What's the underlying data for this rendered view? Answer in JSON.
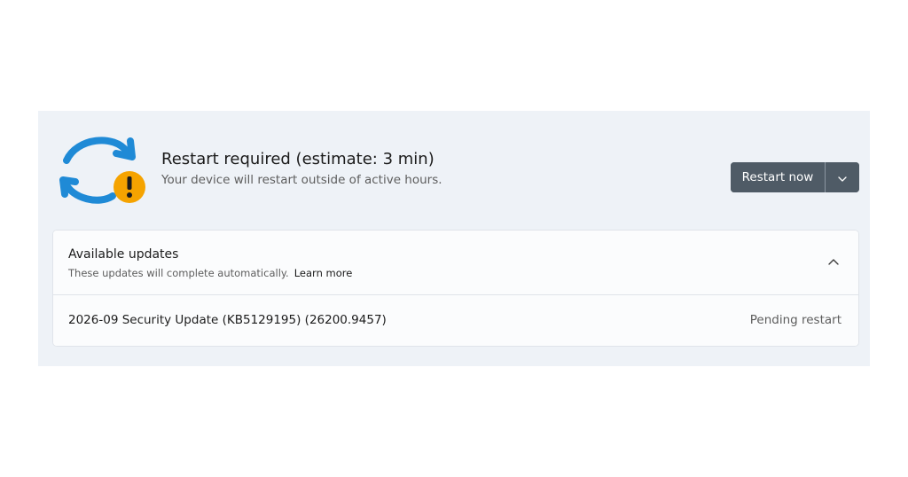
{
  "status": {
    "title": "Restart required (estimate: 3 min)",
    "subtitle": "Your device will restart outside of active hours.",
    "icon": "sync-warning-icon"
  },
  "actions": {
    "restart_label": "Restart now",
    "dropdown_icon": "chevron-down-icon"
  },
  "updates": {
    "title": "Available updates",
    "description": "These updates will complete automatically.",
    "learn_more": "Learn more",
    "toggle_icon": "chevron-up-icon",
    "items": [
      {
        "name": "2026-09 Security Update (KB5129195) (26200.9457)",
        "status": "Pending restart"
      }
    ]
  },
  "colors": {
    "panel_background": "#eef2f7",
    "button": "#4f5b66",
    "sync_arrows": "#1f8ad6",
    "warning_badge": "#f5a300"
  }
}
